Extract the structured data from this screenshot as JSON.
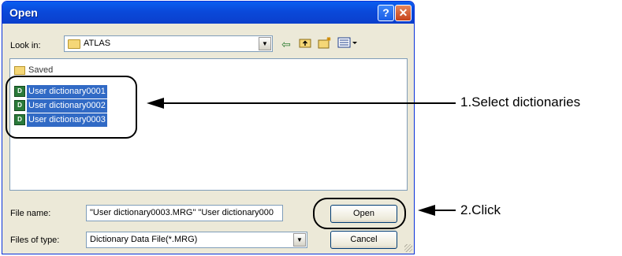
{
  "window": {
    "title": "Open",
    "help_glyph": "?",
    "close_glyph": "✕"
  },
  "lookin": {
    "label": "Look in:",
    "value": "ATLAS",
    "dropdown_glyph": "▼",
    "toolbar_icons": [
      "back-icon",
      "up-folder-icon",
      "new-folder-icon",
      "views-menu-icon"
    ]
  },
  "file_list": {
    "partial_folder": "Saved",
    "items": [
      "User dictionary0001",
      "User dictionary0002",
      "User dictionary0003"
    ]
  },
  "filename": {
    "label": "File name:",
    "value": "\"User dictionary0003.MRG\" \"User dictionary000"
  },
  "filetype": {
    "label": "Files of type:",
    "value": "Dictionary Data File(*.MRG)",
    "dropdown_glyph": "▼"
  },
  "buttons": {
    "open": "Open",
    "cancel": "Cancel"
  },
  "annotations": {
    "step1": "1.Select dictionaries",
    "step2": "2.Click"
  },
  "colors": {
    "titlebar": "#0a49da",
    "selection": "#316ac5",
    "dialog_bg": "#ece9d8"
  }
}
